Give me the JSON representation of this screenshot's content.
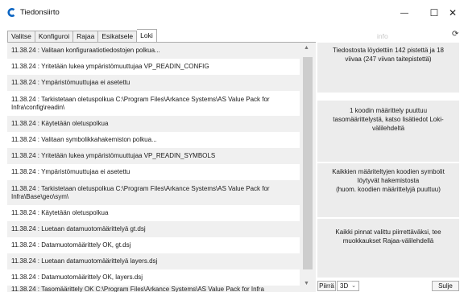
{
  "window": {
    "title": "Tiedonsiirto",
    "minimize_glyph": "—",
    "maximize_glyph": "☐",
    "close_glyph": "✕",
    "brand_color": "#0a64c2"
  },
  "tabs": [
    {
      "label": "Valitse",
      "active": false
    },
    {
      "label": "Konfiguroi",
      "active": false
    },
    {
      "label": "Rajaa",
      "active": false
    },
    {
      "label": "Esikatsele",
      "active": false
    },
    {
      "label": "Loki",
      "active": true
    }
  ],
  "right_header": {
    "info_label": "info",
    "refresh_glyph": "⟳"
  },
  "log": {
    "entries": [
      "11.38.24 : Valitaan konfiguraatiotiedostojen polkua...",
      "11.38.24 : Yritetään lukea ympäristömuuttujaa VP_READIN_CONFIG",
      "11.38.24 : Ympäristömuuttujaa ei asetettu",
      "11.38.24 : Tarkistetaan oletuspolkua C:\\Program Files\\Arkance Systems\\AS Value Pack for Infra\\config\\readin\\",
      "11.38.24 : Käytetään oletuspolkua",
      "11.38.24 : Valitaan symbolikkahakemiston polkua...",
      "11.38.24 : Yritetään lukea ympäristömuuttujaa VP_READIN_SYMBOLS",
      "11.38.24 : Ympäristömuuttujaa ei asetettu",
      "11.38.24 : Tarkistetaan oletuspolkua C:\\Program Files\\Arkance Systems\\AS Value Pack for Infra\\Base\\geo\\sym\\",
      "11.38.24 : Käytetään oletuspolkua",
      "11.38.24 : Luetaan datamuotomäärittelyä gt.dsj",
      "11.38.24 : Datamuotomäärittely OK, gt.dsj",
      "11.38.24 : Luetaan datamuotomäärittelyä layers.dsj",
      "11.38.24 : Datamuotomäärittely OK, layers.dsj",
      "11.38.24 : Tasomäärittely OK C:\\Program Files\\Arkance Systems\\AS Value Pack for Infra"
    ]
  },
  "scrollbar": {
    "up_glyph": "▲",
    "down_glyph": "▼"
  },
  "messages": [
    "Tiedostosta löydettiin 142 pistettä ja 18 viivaa (247 viivan taitepistettä)",
    "1 koodin määrittely puuttuu tasomäärittelystä, katso lisätiedot Loki-välilehdeltä",
    "Kaikkien määriteltyjen koodien symbolit löytyvät hakemistosta\n(huom. koodien määrittelyjä puuttuu)",
    "Kaikki pinnat valittu piirrettäväksi, tee muokkaukset Rajaa-välilehdellä"
  ],
  "footer": {
    "draw_button": "Piirrä",
    "mode_select_value": "3D",
    "close_button": "Sulje"
  }
}
